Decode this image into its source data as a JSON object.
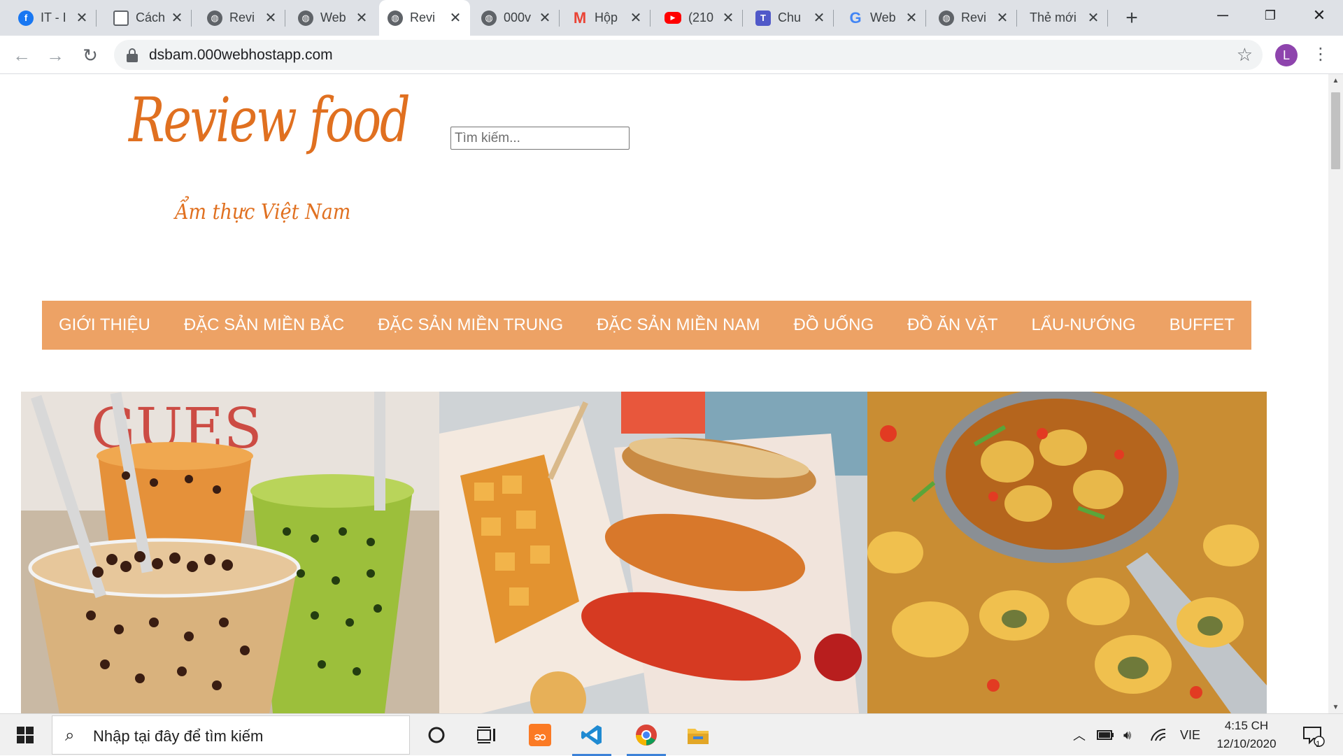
{
  "browser": {
    "tabs": [
      {
        "title": "IT - I",
        "icon": "facebook-icon",
        "active": false
      },
      {
        "title": "Cách",
        "icon": "document-icon",
        "active": false
      },
      {
        "title": "Revi",
        "icon": "globe-icon",
        "active": false
      },
      {
        "title": "Web",
        "icon": "globe-icon",
        "active": false
      },
      {
        "title": "Revi",
        "icon": "globe-icon",
        "active": true
      },
      {
        "title": "000v",
        "icon": "globe-icon",
        "active": false
      },
      {
        "title": "Hộp",
        "icon": "gmail-icon",
        "active": false
      },
      {
        "title": "(210",
        "icon": "youtube-icon",
        "active": false
      },
      {
        "title": "Chu",
        "icon": "teams-icon",
        "active": false
      },
      {
        "title": "Web",
        "icon": "google-icon",
        "active": false
      },
      {
        "title": "Revi",
        "icon": "globe-icon",
        "active": false
      },
      {
        "title": "Thẻ mới",
        "icon": "none",
        "active": false
      }
    ],
    "new_tab_glyph": "+",
    "url": "dsbam.000webhostapp.com",
    "profile_initial": "L"
  },
  "page": {
    "logo_text": "Review food",
    "tagline": "Ẩm thực Việt Nam",
    "search_placeholder": "Tìm kiếm...",
    "nav_items": [
      "GIỚI THIỆU",
      "ĐẶC SẢN MIỀN BẮC",
      "ĐẶC SẢN MIỀN TRUNG",
      "ĐẶC SẢN MIỀN NAM",
      "ĐỒ UỐNG",
      "ĐỒ ĂN VẶT",
      "LẨU-NƯỚNG",
      "BUFFET"
    ],
    "nav_color": "#eda265",
    "brand_color": "#e07020",
    "banner_images": [
      "bubble-tea-image",
      "corn-dog-image",
      "snail-dish-image"
    ]
  },
  "taskbar": {
    "search_text": "Nhập tại đây để tìm kiếm",
    "language": "VIE",
    "time": "4:15 CH",
    "date": "12/10/2020",
    "notification_count": "1",
    "apps": [
      "task-view-icon",
      "xampp-icon",
      "vscode-icon",
      "chrome-icon",
      "file-explorer-icon"
    ]
  }
}
